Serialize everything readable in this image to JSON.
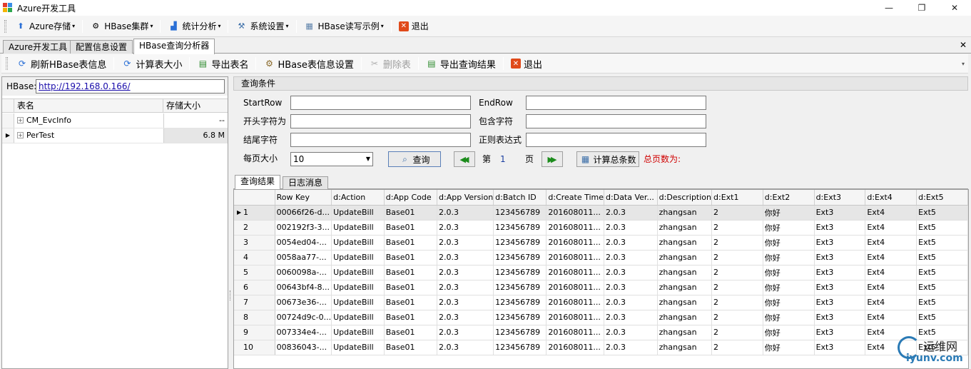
{
  "window": {
    "title": "Azure开发工具",
    "minimize": "—",
    "maximize": "❐",
    "close": "✕"
  },
  "menubar": {
    "items": [
      {
        "label": "Azure存储",
        "icon": "rocket-icon",
        "glyph": "🚀"
      },
      {
        "label": "HBase集群",
        "icon": "cluster-icon",
        "glyph": "⚙"
      },
      {
        "label": "统计分析",
        "icon": "chart-icon",
        "glyph": "📈"
      },
      {
        "label": "系统设置",
        "icon": "settings-icon",
        "glyph": "🛠"
      },
      {
        "label": "HBase读写示例",
        "icon": "grid-icon",
        "glyph": "▦"
      },
      {
        "label": "退出",
        "icon": "exit-icon",
        "glyph": "✕"
      }
    ]
  },
  "doc_tabs": {
    "tabs": [
      "Azure开发工具",
      "配置信息设置",
      "HBase查询分析器"
    ],
    "active": 2,
    "close": "✕"
  },
  "toolbar": {
    "refresh": "刷新HBase表信息",
    "calc_size": "计算表大小",
    "export_names": "导出表名",
    "table_settings": "HBase表信息设置",
    "delete_table": "删除表",
    "export_results": "导出查询结果",
    "exit": "退出",
    "overflow": "▾"
  },
  "left": {
    "hbase_label": "HBase:",
    "hbase_url": "http://192.168.0.166/",
    "columns": {
      "name": "表名",
      "size": "存储大小"
    },
    "tables": [
      {
        "name": "CM_EvcInfo",
        "size": "--"
      },
      {
        "name": "PerTest",
        "size": "6.8 M"
      }
    ],
    "selected_row": 1
  },
  "query": {
    "title": "查询条件",
    "start_row": "StartRow",
    "end_row": "EndRow",
    "prefix": "开头字符为",
    "contains": "包含字符",
    "suffix": "结尾字符",
    "regex": "正则表达式",
    "page_size_label": "每页大小",
    "page_size": "10",
    "query_button": "查询",
    "page_prefix": "第",
    "page_number": "1",
    "page_suffix": "页",
    "count_button": "计算总条数",
    "total_pages": "总页数为:",
    "prev_glyph": "◀◀",
    "next_glyph": "▶▶"
  },
  "result_tabs": {
    "tabs": [
      "查询结果",
      "日志消息"
    ],
    "active": 0
  },
  "grid": {
    "columns": [
      "Row Key",
      "d:Action",
      "d:App Code",
      "d:App Version",
      "d:Batch ID",
      "d:Create Time",
      "d:Data Ver...",
      "d:Description",
      "d:Ext1",
      "d:Ext2",
      "d:Ext3",
      "d:Ext4",
      "d:Ext5"
    ],
    "rows": [
      [
        "1",
        "00066f26-d...",
        "UpdateBill",
        "Base01",
        "2.0.3",
        "123456789",
        "201608011...",
        "2.0.3",
        "zhangsan",
        "2",
        "你好",
        "Ext3",
        "Ext4",
        "Ext5"
      ],
      [
        "2",
        "002192f3-3...",
        "UpdateBill",
        "Base01",
        "2.0.3",
        "123456789",
        "201608011...",
        "2.0.3",
        "zhangsan",
        "2",
        "你好",
        "Ext3",
        "Ext4",
        "Ext5"
      ],
      [
        "3",
        "0054ed04-...",
        "UpdateBill",
        "Base01",
        "2.0.3",
        "123456789",
        "201608011...",
        "2.0.3",
        "zhangsan",
        "2",
        "你好",
        "Ext3",
        "Ext4",
        "Ext5"
      ],
      [
        "4",
        "0058aa77-...",
        "UpdateBill",
        "Base01",
        "2.0.3",
        "123456789",
        "201608011...",
        "2.0.3",
        "zhangsan",
        "2",
        "你好",
        "Ext3",
        "Ext4",
        "Ext5"
      ],
      [
        "5",
        "0060098a-...",
        "UpdateBill",
        "Base01",
        "2.0.3",
        "123456789",
        "201608011...",
        "2.0.3",
        "zhangsan",
        "2",
        "你好",
        "Ext3",
        "Ext4",
        "Ext5"
      ],
      [
        "6",
        "00643bf4-8...",
        "UpdateBill",
        "Base01",
        "2.0.3",
        "123456789",
        "201608011...",
        "2.0.3",
        "zhangsan",
        "2",
        "你好",
        "Ext3",
        "Ext4",
        "Ext5"
      ],
      [
        "7",
        "00673e36-...",
        "UpdateBill",
        "Base01",
        "2.0.3",
        "123456789",
        "201608011...",
        "2.0.3",
        "zhangsan",
        "2",
        "你好",
        "Ext3",
        "Ext4",
        "Ext5"
      ],
      [
        "8",
        "00724d9c-0...",
        "UpdateBill",
        "Base01",
        "2.0.3",
        "123456789",
        "201608011...",
        "2.0.3",
        "zhangsan",
        "2",
        "你好",
        "Ext3",
        "Ext4",
        "Ext5"
      ],
      [
        "9",
        "007334e4-...",
        "UpdateBill",
        "Base01",
        "2.0.3",
        "123456789",
        "201608011...",
        "2.0.3",
        "zhangsan",
        "2",
        "你好",
        "Ext3",
        "Ext4",
        "Ext5"
      ],
      [
        "10",
        "00836043-...",
        "UpdateBill",
        "Base01",
        "2.0.3",
        "123456789",
        "201608011...",
        "2.0.3",
        "zhangsan",
        "2",
        "你好",
        "Ext3",
        "Ext4",
        "Ext5"
      ]
    ],
    "selected_row": 0
  },
  "watermark": {
    "cn": "运维网",
    "en": "iyunv.com"
  },
  "colors": {
    "accent_red": "#d00000",
    "link": "#1a0dab",
    "selection": "#e6e6e6",
    "nav_green": "#1c8c1c"
  }
}
